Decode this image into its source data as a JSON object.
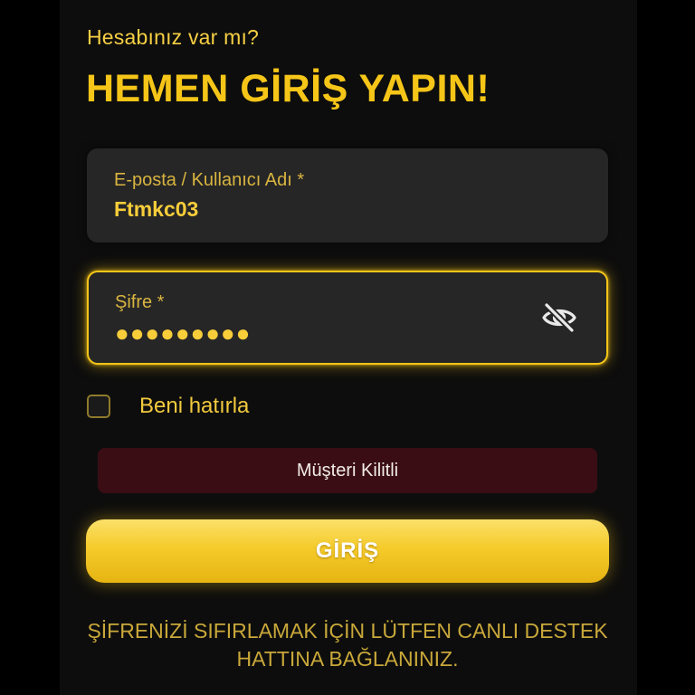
{
  "colors": {
    "accent": "#f5c518",
    "field_background": "#262626",
    "alert_background": "#3a0d14",
    "page_background": "#000000"
  },
  "header": {
    "subtitle": "Hesabınız var mı?",
    "title": "HEMEN GİRİŞ YAPIN!"
  },
  "form": {
    "email": {
      "label": "E-posta / Kullanıcı Adı *",
      "value": "Ftmkc03"
    },
    "password": {
      "label": "Şifre *",
      "masked_value": "●●●●●●●●●",
      "toggle_icon": "eye-slash-icon"
    },
    "remember_me": {
      "label": "Beni hatırla",
      "checked": false
    },
    "error_message": "Müşteri Kilitli",
    "submit_label": "GİRİŞ"
  },
  "footer": {
    "notice": "ŞİFRENİZİ SIFIRLAMAK İÇİN LÜTFEN CANLI DESTEK HATTINA BAĞLANINIZ."
  }
}
